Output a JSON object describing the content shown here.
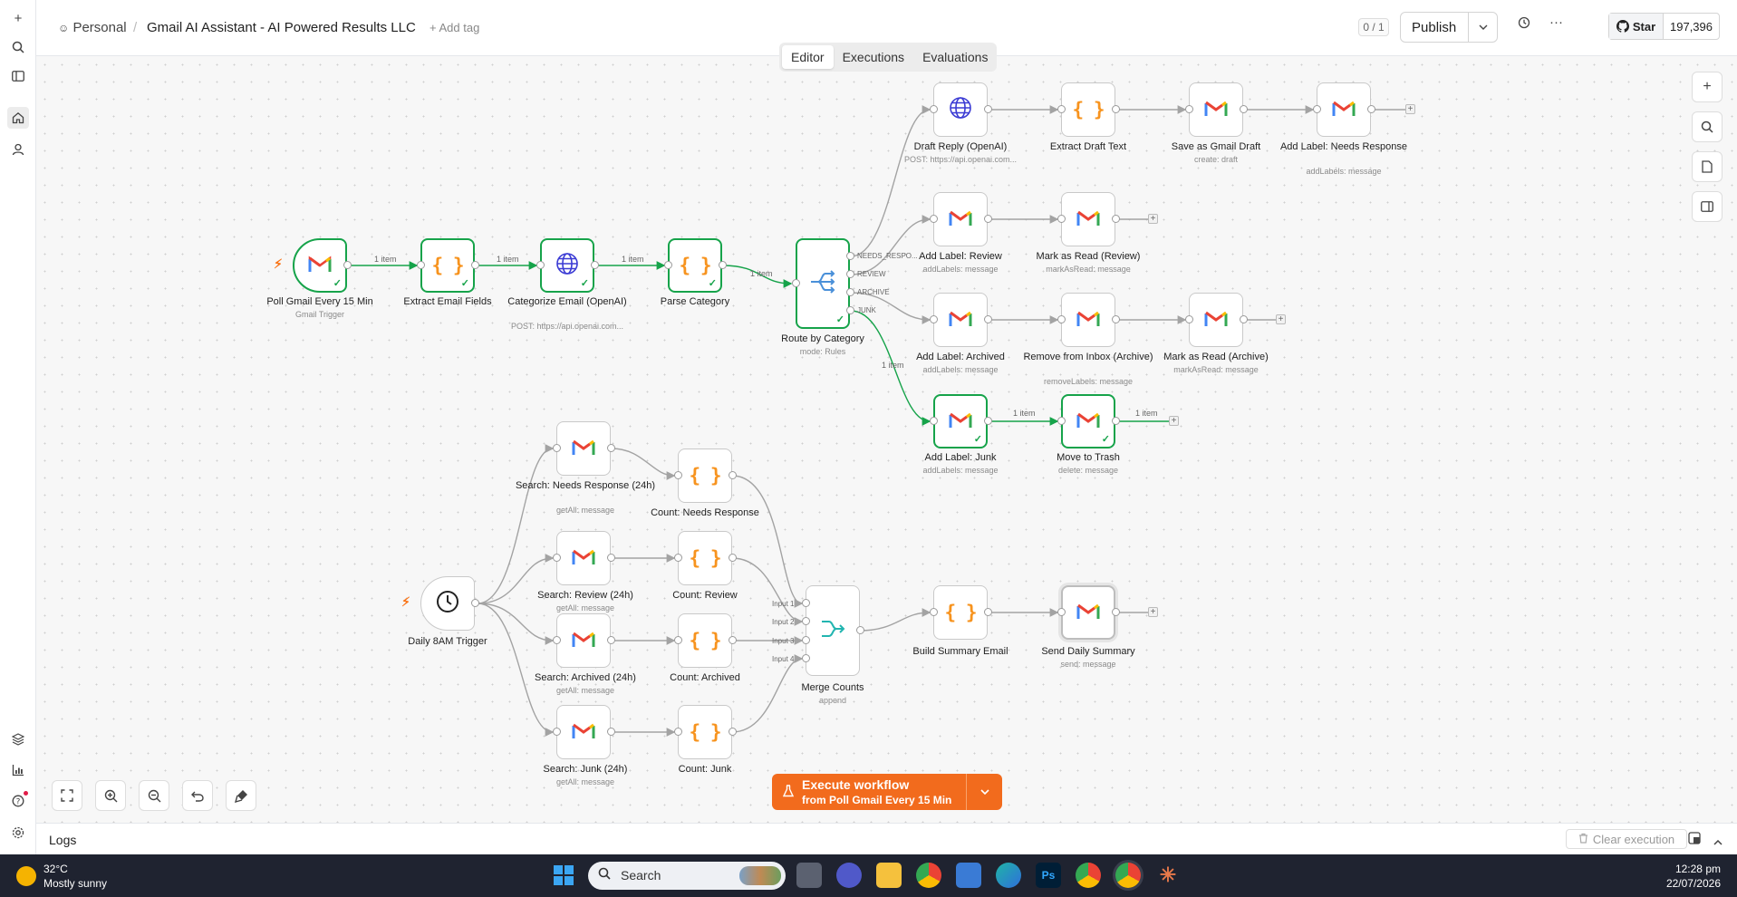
{
  "header": {
    "project": "Personal",
    "workflow_name": "Gmail AI Assistant - AI Powered Results LLC",
    "add_tag": "+ Add tag",
    "counter": "0 / 1",
    "publish": "Publish",
    "github_star": "Star",
    "github_count": "197,396"
  },
  "tabs": [
    "Editor",
    "Executions",
    "Evaluations"
  ],
  "nodes": {
    "poll": {
      "label": "Poll Gmail Every 15 Min",
      "sub": "Gmail Trigger"
    },
    "extract_fields": {
      "label": "Extract Email Fields"
    },
    "categorize": {
      "label": "Categorize Email (OpenAI)",
      "sub": "POST: https://api.openai.com..."
    },
    "parse": {
      "label": "Parse Category"
    },
    "route": {
      "label": "Route by Category",
      "sub": "mode: Rules"
    },
    "draft_reply": {
      "label": "Draft Reply (OpenAI)",
      "sub": "POST: https://api.openai.com..."
    },
    "extract_draft": {
      "label": "Extract Draft Text"
    },
    "save_draft": {
      "label": "Save as Gmail Draft",
      "sub": "create: draft"
    },
    "label_needs": {
      "label": "Add Label: Needs Response",
      "sub": "addLabels: message"
    },
    "label_review": {
      "label": "Add Label: Review",
      "sub": "addLabels: message"
    },
    "read_review": {
      "label": "Mark as Read (Review)",
      "sub": "markAsRead: message"
    },
    "label_archived": {
      "label": "Add Label: Archived",
      "sub": "addLabels: message"
    },
    "remove_inbox": {
      "label": "Remove from Inbox (Archive)",
      "sub": "removeLabels: message"
    },
    "read_archive": {
      "label": "Mark as Read (Archive)",
      "sub": "markAsRead: message"
    },
    "label_junk": {
      "label": "Add Label: Junk",
      "sub": "addLabels: message"
    },
    "trash": {
      "label": "Move to Trash",
      "sub": "delete: message"
    },
    "daily": {
      "label": "Daily 8AM Trigger"
    },
    "search_needs": {
      "label": "Search: Needs Response (24h)",
      "sub": "getAll: message"
    },
    "count_needs": {
      "label": "Count: Needs Response"
    },
    "search_review": {
      "label": "Search: Review (24h)",
      "sub": "getAll: message"
    },
    "count_review": {
      "label": "Count: Review"
    },
    "search_archived": {
      "label": "Search: Archived (24h)",
      "sub": "getAll: message"
    },
    "count_archived": {
      "label": "Count: Archived"
    },
    "search_junk": {
      "label": "Search: Junk (24h)",
      "sub": "getAll: message"
    },
    "count_junk": {
      "label": "Count: Junk"
    },
    "merge": {
      "label": "Merge Counts",
      "sub": "append"
    },
    "build_summary": {
      "label": "Build Summary Email"
    },
    "send_summary": {
      "label": "Send Daily Summary",
      "sub": "send: message"
    }
  },
  "edge_labels": {
    "item": "1 item",
    "needs": "NEEDS_RESPO...",
    "review": "REVIEW",
    "archive": "ARCHIVE",
    "junk": "JUNK",
    "input1": "Input 1",
    "input2": "Input 2",
    "input3": "Input 3",
    "input4": "Input 4"
  },
  "execute": {
    "title": "Execute workflow",
    "subtitle": "from Poll Gmail Every 15 Min"
  },
  "logs": {
    "title": "Logs",
    "clear": "Clear execution"
  },
  "taskbar": {
    "temperature": "32°C",
    "condition": "Mostly sunny",
    "search": "Search",
    "time": "12:28 pm",
    "date": "22/07/2026"
  },
  "colors": {
    "success": "#16a34a",
    "accent": "#f26b1d",
    "code": "#f7931e"
  }
}
